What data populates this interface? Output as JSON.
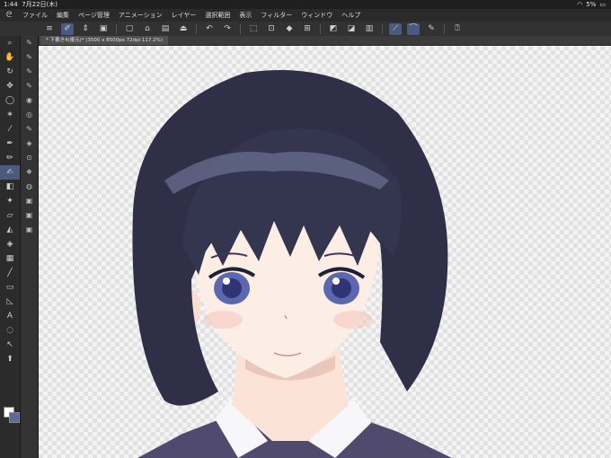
{
  "status": {
    "time": "1:44",
    "date": "7月22日(木)",
    "battery": "5%"
  },
  "menu": [
    "ファイル",
    "編集",
    "ページ管理",
    "アニメーション",
    "レイヤー",
    "選択範囲",
    "表示",
    "フィルター",
    "ウィンドウ",
    "ヘルプ"
  ],
  "document": {
    "tab_label": "* 下書き4(複元)* (3500 x 8500px 72dpi 117.2%)"
  },
  "colors": {
    "main": "#ffffff",
    "sub": "#5d6a93",
    "accent": "#4b5b80"
  }
}
